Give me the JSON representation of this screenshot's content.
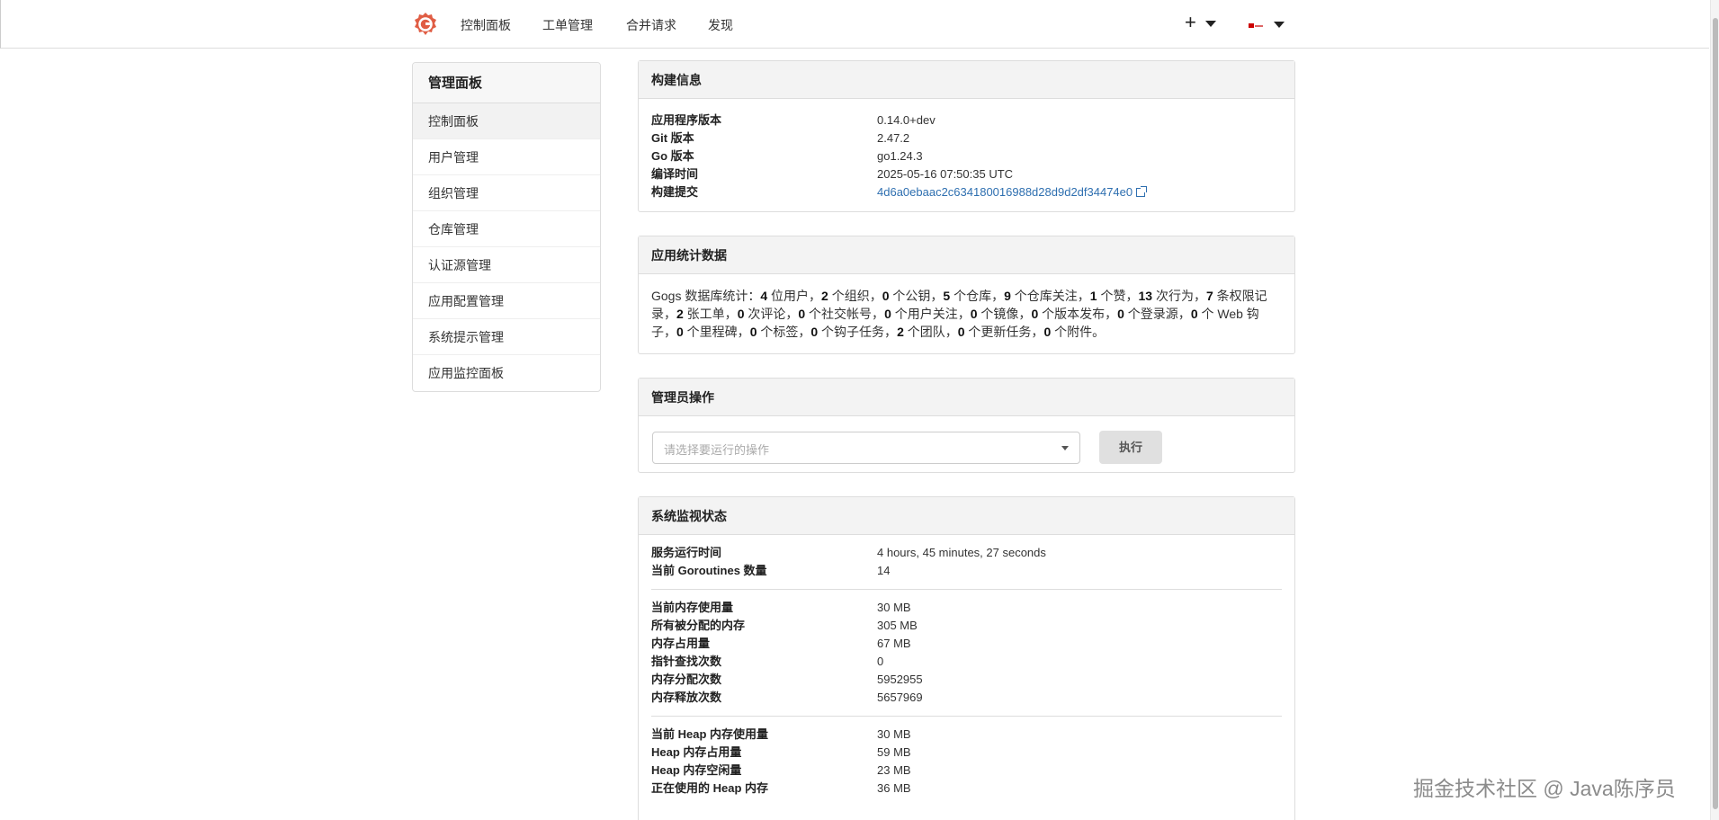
{
  "header": {
    "nav": [
      "控制面板",
      "工单管理",
      "合并请求",
      "发现"
    ],
    "plus_label": "+"
  },
  "sidebar": {
    "title": "管理面板",
    "items": [
      {
        "label": "控制面板",
        "active": true
      },
      {
        "label": "用户管理"
      },
      {
        "label": "组织管理"
      },
      {
        "label": "仓库管理"
      },
      {
        "label": "认证源管理"
      },
      {
        "label": "应用配置管理"
      },
      {
        "label": "系统提示管理"
      },
      {
        "label": "应用监控面板"
      }
    ]
  },
  "build_info": {
    "title": "构建信息",
    "rows": [
      {
        "key": "应用程序版本",
        "value": "0.14.0+dev"
      },
      {
        "key": "Git 版本",
        "value": "2.47.2"
      },
      {
        "key": "Go 版本",
        "value": "go1.24.3"
      },
      {
        "key": "编译时间",
        "value": "2025-05-16 07:50:35 UTC"
      },
      {
        "key": "构建提交",
        "value": "4d6a0ebaac2c634180016988d28d9d2df34474e0"
      }
    ]
  },
  "app_stats": {
    "title": "应用统计数据",
    "prefix": "Gogs 数据库统计：",
    "items": [
      {
        "n": "4",
        "label": " 位用户，"
      },
      {
        "n": "2",
        "label": " 个组织，"
      },
      {
        "n": "0",
        "label": " 个公钥，"
      },
      {
        "n": "5",
        "label": " 个仓库，"
      },
      {
        "n": "9",
        "label": " 个仓库关注，"
      },
      {
        "n": "1",
        "label": " 个赞，"
      },
      {
        "n": "13",
        "label": " 次行为，"
      },
      {
        "n": "7",
        "label": " 条权限记录，"
      },
      {
        "n": "2",
        "label": " 张工单，"
      },
      {
        "n": "0",
        "label": " 次评论，"
      },
      {
        "n": "0",
        "label": " 个社交帐号，"
      },
      {
        "n": "0",
        "label": " 个用户关注，"
      },
      {
        "n": "0",
        "label": " 个镜像，"
      },
      {
        "n": "0",
        "label": " 个版本发布，"
      },
      {
        "n": "0",
        "label": " 个登录源，"
      },
      {
        "n": "0",
        "label": " 个 Web 钩子，"
      },
      {
        "n": "0",
        "label": " 个里程碑，"
      },
      {
        "n": "0",
        "label": " 个标签，"
      },
      {
        "n": "0",
        "label": " 个钩子任务，"
      },
      {
        "n": "2",
        "label": " 个团队，"
      },
      {
        "n": "0",
        "label": " 个更新任务，"
      },
      {
        "n": "0",
        "label": " 个附件。"
      }
    ]
  },
  "admin_ops": {
    "title": "管理员操作",
    "select_placeholder": "请选择要运行的操作",
    "run_label": "执行"
  },
  "monitor": {
    "title": "系统监视状态",
    "groups": [
      [
        {
          "key": "服务运行时间",
          "value": "4 hours, 45 minutes, 27 seconds"
        },
        {
          "key": "当前 Goroutines 数量",
          "value": "14"
        }
      ],
      [
        {
          "key": "当前内存使用量",
          "value": "30 MB"
        },
        {
          "key": "所有被分配的内存",
          "value": "305 MB"
        },
        {
          "key": "内存占用量",
          "value": "67 MB"
        },
        {
          "key": "指针查找次数",
          "value": "0"
        },
        {
          "key": "内存分配次数",
          "value": "5952955"
        },
        {
          "key": "内存释放次数",
          "value": "5657969"
        }
      ],
      [
        {
          "key": "当前 Heap 内存使用量",
          "value": "30 MB"
        },
        {
          "key": "Heap 内存占用量",
          "value": "59 MB"
        },
        {
          "key": "Heap 内存空闲量",
          "value": "23 MB"
        },
        {
          "key": "正在使用的 Heap 内存",
          "value": "36 MB"
        }
      ]
    ]
  },
  "watermark": "掘金技术社区 @ Java陈序员"
}
